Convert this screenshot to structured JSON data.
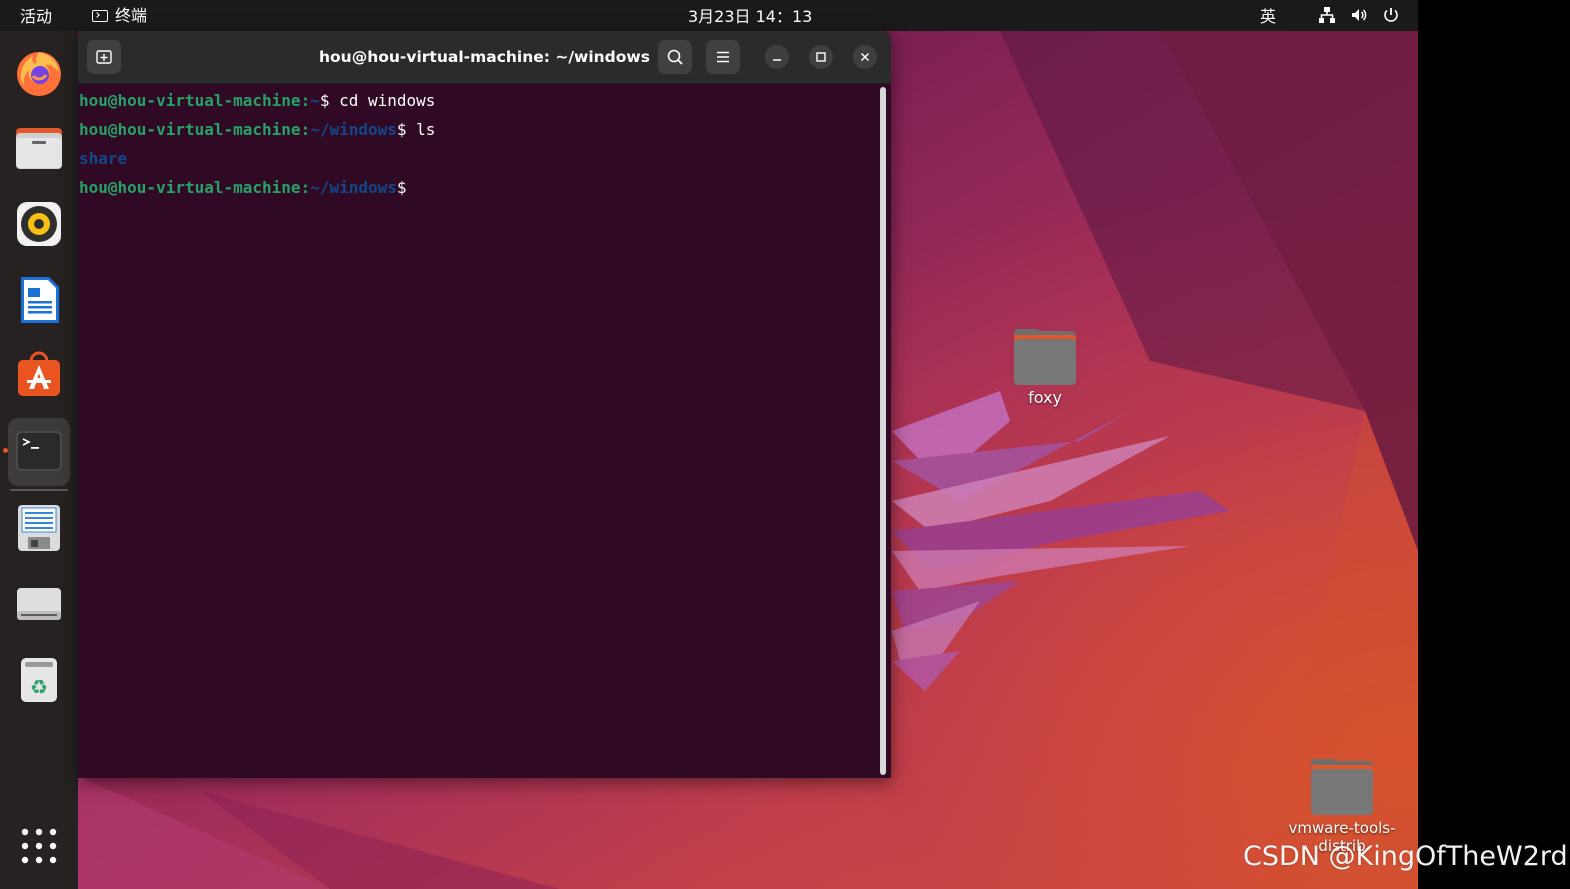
{
  "topbar": {
    "activities": "活动",
    "app_name": "终端",
    "clock": "3月23日  14：13",
    "input_method": "英"
  },
  "terminal": {
    "title": "hou@hou-virtual-machine: ~/windows",
    "lines": {
      "l1": {
        "user": "hou@hou-virtual-machine",
        "colon": ":",
        "path": "~",
        "prompt": "$ ",
        "cmd": "cd windows"
      },
      "l2": {
        "user": "hou@hou-virtual-machine",
        "colon": ":",
        "path": "~/windows",
        "prompt": "$ ",
        "cmd": "ls"
      },
      "l3": {
        "output": "share"
      },
      "l4": {
        "user": "hou@hou-virtual-machine",
        "colon": ":",
        "path": "~/windows",
        "prompt": "$",
        "cmd": ""
      }
    }
  },
  "dock": {
    "items": [
      "firefox",
      "files",
      "rhythmbox",
      "libreoffice-writer",
      "app-center",
      "terminal",
      "save-document",
      "drive",
      "trash",
      "show-apps"
    ]
  },
  "desktop": {
    "icons": {
      "foxy": "foxy",
      "vmware": "vmware-tools-distrib"
    }
  },
  "watermark": "CSDN @KingOfTheW2rd",
  "colors": {
    "terminal_bg": "#300a24",
    "prompt_user": "#26a269",
    "prompt_path": "#12488b",
    "accent": "#e95420"
  }
}
